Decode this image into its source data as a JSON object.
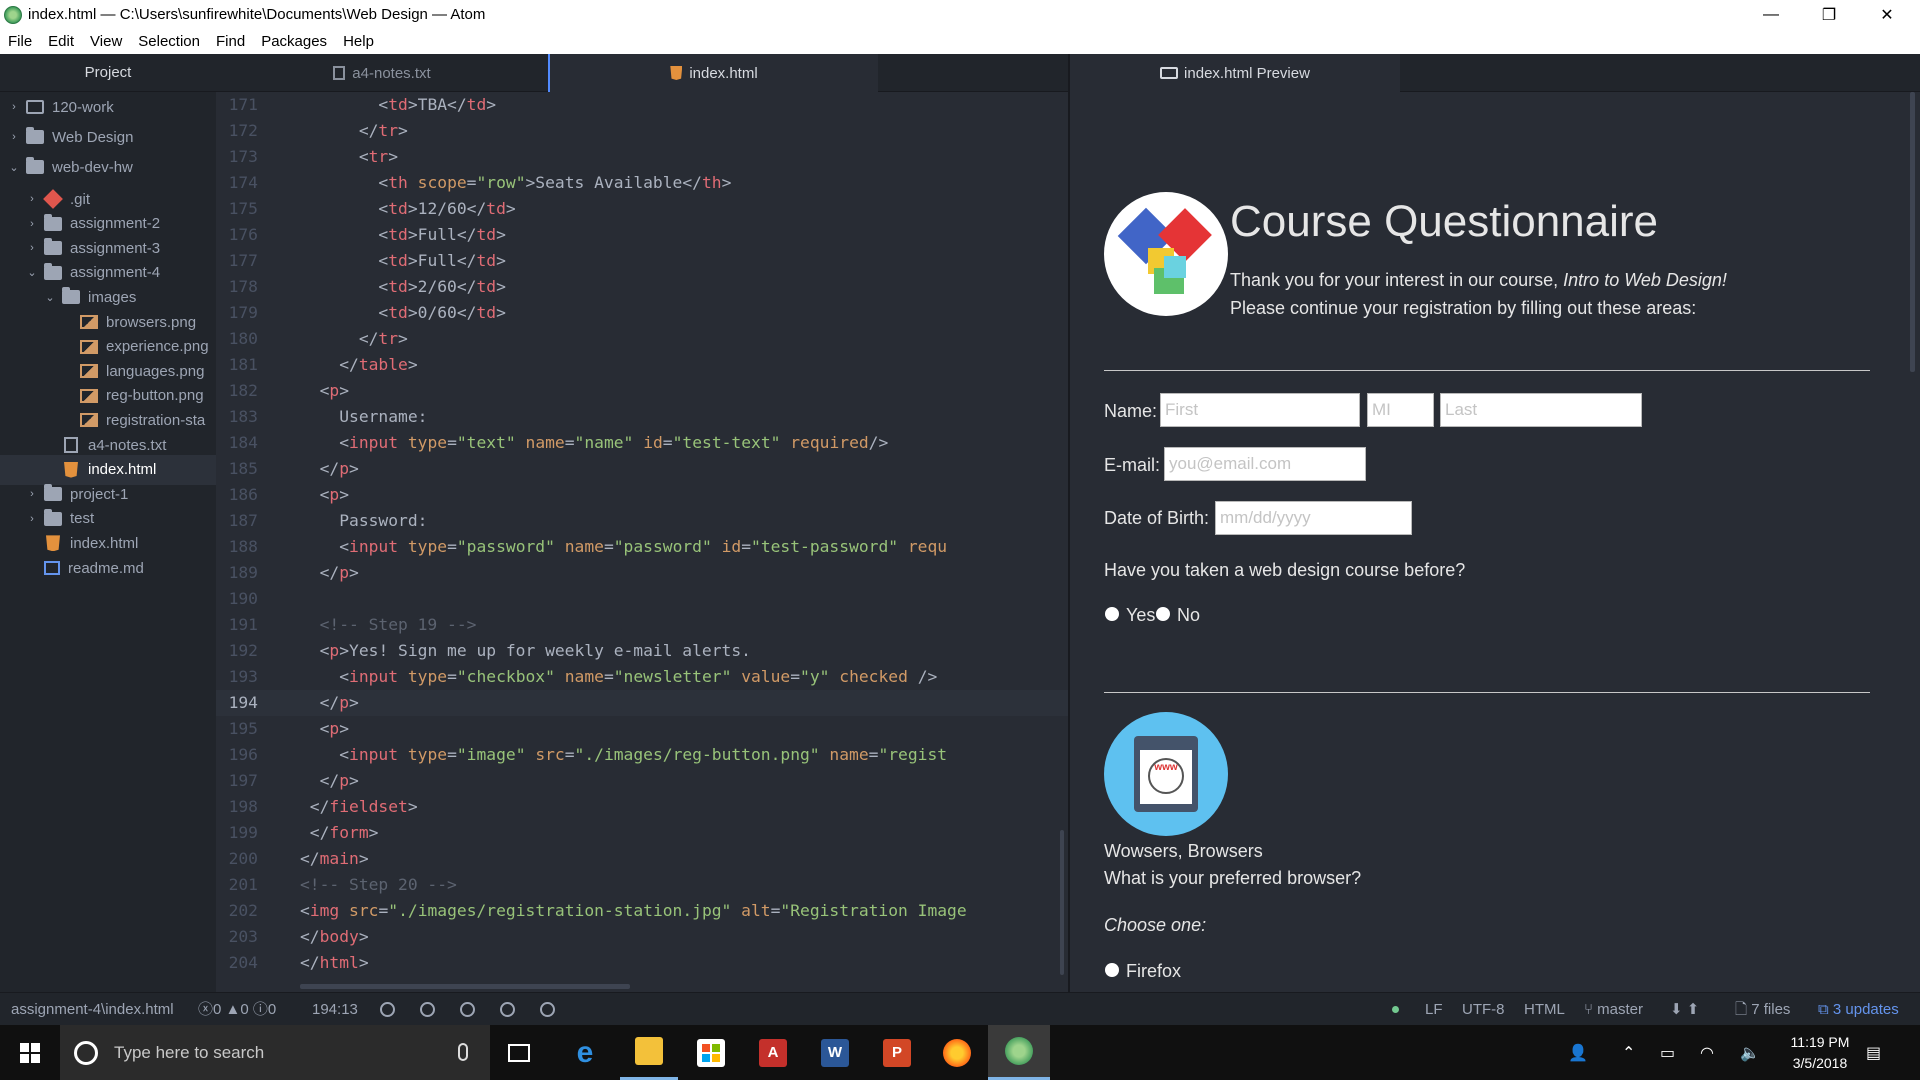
{
  "window": {
    "title": "index.html — C:\\Users\\sunfirewhite\\Documents\\Web Design — Atom",
    "controls": {
      "minimize": "—",
      "maximize": "❐",
      "close": "✕"
    }
  },
  "menu": [
    "File",
    "Edit",
    "View",
    "Selection",
    "Find",
    "Packages",
    "Help"
  ],
  "tree": {
    "header": "Project",
    "items": [
      {
        "label": "120-work",
        "icon": "repo-icon",
        "chevron": "›",
        "depth": 0
      },
      {
        "label": "Web Design",
        "icon": "folder-icon",
        "chevron": "›",
        "depth": 0
      },
      {
        "label": "web-dev-hw",
        "icon": "folder-icon",
        "chevron": "⌄",
        "depth": 0
      },
      {
        "label": ".git",
        "icon": "git-icon",
        "chevron": "›",
        "depth": 1
      },
      {
        "label": "assignment-2",
        "icon": "folder-icon",
        "chevron": "›",
        "depth": 1
      },
      {
        "label": "assignment-3",
        "icon": "folder-icon",
        "chevron": "›",
        "depth": 1
      },
      {
        "label": "assignment-4",
        "icon": "folder-icon",
        "chevron": "⌄",
        "depth": 1
      },
      {
        "label": "images",
        "icon": "folder-icon",
        "chevron": "⌄",
        "depth": 2
      },
      {
        "label": "browsers.png",
        "icon": "image-file-icon",
        "chevron": "",
        "depth": 3
      },
      {
        "label": "experience.png",
        "icon": "image-file-icon",
        "chevron": "",
        "depth": 3
      },
      {
        "label": "languages.png",
        "icon": "image-file-icon",
        "chevron": "",
        "depth": 3
      },
      {
        "label": "reg-button.png",
        "icon": "image-file-icon",
        "chevron": "",
        "depth": 3
      },
      {
        "label": "registration-sta",
        "icon": "image-file-icon",
        "chevron": "",
        "depth": 3
      },
      {
        "label": "a4-notes.txt",
        "icon": "text-file-icon",
        "chevron": "",
        "depth": 2
      },
      {
        "label": "index.html",
        "icon": "html5-icon",
        "chevron": "",
        "depth": 2,
        "selected": true
      },
      {
        "label": "project-1",
        "icon": "folder-icon",
        "chevron": "›",
        "depth": 1
      },
      {
        "label": "test",
        "icon": "folder-icon",
        "chevron": "›",
        "depth": 1
      },
      {
        "label": "index.html",
        "icon": "html5-icon",
        "chevron": "",
        "depth": 1
      },
      {
        "label": "readme.md",
        "icon": "markdown-file-icon",
        "chevron": "",
        "depth": 1
      }
    ]
  },
  "tabs": [
    {
      "label": "a4-notes.txt",
      "icon": "text-file-icon",
      "active": false
    },
    {
      "label": "index.html",
      "icon": "html5-icon",
      "active": true
    }
  ],
  "editor": {
    "cursor_line": 194,
    "lines": [
      {
        "n": "171",
        "tokens": [
          [
            "p",
            "        <"
          ],
          [
            "t",
            "td"
          ],
          [
            "p",
            ">TBA</"
          ],
          [
            "t",
            "td"
          ],
          [
            "p",
            ">"
          ]
        ]
      },
      {
        "n": "172",
        "tokens": [
          [
            "p",
            "      </"
          ],
          [
            "t",
            "tr"
          ],
          [
            "p",
            ">"
          ]
        ]
      },
      {
        "n": "173",
        "tokens": [
          [
            "p",
            "      <"
          ],
          [
            "t",
            "tr"
          ],
          [
            "p",
            ">"
          ]
        ]
      },
      {
        "n": "174",
        "tokens": [
          [
            "p",
            "        <"
          ],
          [
            "t",
            "th"
          ],
          [
            "p",
            " "
          ],
          [
            "a",
            "scope"
          ],
          [
            "p",
            "="
          ],
          [
            "s",
            "\"row\""
          ],
          [
            "p",
            ">Seats Available</"
          ],
          [
            "t",
            "th"
          ],
          [
            "p",
            ">"
          ]
        ]
      },
      {
        "n": "175",
        "tokens": [
          [
            "p",
            "        <"
          ],
          [
            "t",
            "td"
          ],
          [
            "p",
            ">12/60</"
          ],
          [
            "t",
            "td"
          ],
          [
            "p",
            ">"
          ]
        ]
      },
      {
        "n": "176",
        "tokens": [
          [
            "p",
            "        <"
          ],
          [
            "t",
            "td"
          ],
          [
            "p",
            ">Full</"
          ],
          [
            "t",
            "td"
          ],
          [
            "p",
            ">"
          ]
        ]
      },
      {
        "n": "177",
        "tokens": [
          [
            "p",
            "        <"
          ],
          [
            "t",
            "td"
          ],
          [
            "p",
            ">Full</"
          ],
          [
            "t",
            "td"
          ],
          [
            "p",
            ">"
          ]
        ]
      },
      {
        "n": "178",
        "tokens": [
          [
            "p",
            "        <"
          ],
          [
            "t",
            "td"
          ],
          [
            "p",
            ">2/60</"
          ],
          [
            "t",
            "td"
          ],
          [
            "p",
            ">"
          ]
        ]
      },
      {
        "n": "179",
        "tokens": [
          [
            "p",
            "        <"
          ],
          [
            "t",
            "td"
          ],
          [
            "p",
            ">0/60</"
          ],
          [
            "t",
            "td"
          ],
          [
            "p",
            ">"
          ]
        ]
      },
      {
        "n": "180",
        "tokens": [
          [
            "p",
            "      </"
          ],
          [
            "t",
            "tr"
          ],
          [
            "p",
            ">"
          ]
        ]
      },
      {
        "n": "181",
        "tokens": [
          [
            "p",
            "    </"
          ],
          [
            "t",
            "table"
          ],
          [
            "p",
            ">"
          ]
        ]
      },
      {
        "n": "182",
        "tokens": [
          [
            "p",
            "  <"
          ],
          [
            "t",
            "p"
          ],
          [
            "p",
            ">"
          ]
        ]
      },
      {
        "n": "183",
        "tokens": [
          [
            "p",
            "    Username:"
          ]
        ]
      },
      {
        "n": "184",
        "tokens": [
          [
            "p",
            "    <"
          ],
          [
            "t",
            "input"
          ],
          [
            "p",
            " "
          ],
          [
            "a",
            "type"
          ],
          [
            "p",
            "="
          ],
          [
            "s",
            "\"text\""
          ],
          [
            "p",
            " "
          ],
          [
            "a",
            "name"
          ],
          [
            "p",
            "="
          ],
          [
            "s",
            "\"name\""
          ],
          [
            "p",
            " "
          ],
          [
            "a",
            "id"
          ],
          [
            "p",
            "="
          ],
          [
            "s",
            "\"test-text\""
          ],
          [
            "p",
            " "
          ],
          [
            "a",
            "required"
          ],
          [
            "p",
            "/>"
          ]
        ]
      },
      {
        "n": "185",
        "tokens": [
          [
            "p",
            "  </"
          ],
          [
            "t",
            "p"
          ],
          [
            "p",
            ">"
          ]
        ]
      },
      {
        "n": "186",
        "tokens": [
          [
            "p",
            "  <"
          ],
          [
            "t",
            "p"
          ],
          [
            "p",
            ">"
          ]
        ]
      },
      {
        "n": "187",
        "tokens": [
          [
            "p",
            "    Password:"
          ]
        ]
      },
      {
        "n": "188",
        "tokens": [
          [
            "p",
            "    <"
          ],
          [
            "t",
            "input"
          ],
          [
            "p",
            " "
          ],
          [
            "a",
            "type"
          ],
          [
            "p",
            "="
          ],
          [
            "s",
            "\"password\""
          ],
          [
            "p",
            " "
          ],
          [
            "a",
            "name"
          ],
          [
            "p",
            "="
          ],
          [
            "s",
            "\"password\""
          ],
          [
            "p",
            " "
          ],
          [
            "a",
            "id"
          ],
          [
            "p",
            "="
          ],
          [
            "s",
            "\"test-password\""
          ],
          [
            "p",
            " "
          ],
          [
            "a",
            "requ"
          ]
        ]
      },
      {
        "n": "189",
        "tokens": [
          [
            "p",
            "  </"
          ],
          [
            "t",
            "p"
          ],
          [
            "p",
            ">"
          ]
        ]
      },
      {
        "n": "190",
        "tokens": []
      },
      {
        "n": "191",
        "tokens": [
          [
            "c",
            "  <!-- Step 19 -->"
          ]
        ]
      },
      {
        "n": "192",
        "tokens": [
          [
            "p",
            "  <"
          ],
          [
            "t",
            "p"
          ],
          [
            "p",
            ">Yes! Sign me up for weekly e-mail alerts."
          ]
        ]
      },
      {
        "n": "193",
        "tokens": [
          [
            "p",
            "    <"
          ],
          [
            "t",
            "input"
          ],
          [
            "p",
            " "
          ],
          [
            "a",
            "type"
          ],
          [
            "p",
            "="
          ],
          [
            "s",
            "\"checkbox\""
          ],
          [
            "p",
            " "
          ],
          [
            "a",
            "name"
          ],
          [
            "p",
            "="
          ],
          [
            "s",
            "\"newsletter\""
          ],
          [
            "p",
            " "
          ],
          [
            "a",
            "value"
          ],
          [
            "p",
            "="
          ],
          [
            "s",
            "\"y\""
          ],
          [
            "p",
            " "
          ],
          [
            "a",
            "checked"
          ],
          [
            "p",
            " />"
          ]
        ]
      },
      {
        "n": "194",
        "tokens": [
          [
            "p",
            "  </"
          ],
          [
            "t",
            "p"
          ],
          [
            "p",
            ">"
          ]
        ]
      },
      {
        "n": "195",
        "tokens": [
          [
            "p",
            "  <"
          ],
          [
            "t",
            "p"
          ],
          [
            "p",
            ">"
          ]
        ]
      },
      {
        "n": "196",
        "tokens": [
          [
            "p",
            "    <"
          ],
          [
            "t",
            "input"
          ],
          [
            "p",
            " "
          ],
          [
            "a",
            "type"
          ],
          [
            "p",
            "="
          ],
          [
            "s",
            "\"image\""
          ],
          [
            "p",
            " "
          ],
          [
            "a",
            "src"
          ],
          [
            "p",
            "="
          ],
          [
            "s",
            "\"./images/reg-button.png\""
          ],
          [
            "p",
            " "
          ],
          [
            "a",
            "name"
          ],
          [
            "p",
            "="
          ],
          [
            "s",
            "\"regist"
          ]
        ]
      },
      {
        "n": "197",
        "tokens": [
          [
            "p",
            "  </"
          ],
          [
            "t",
            "p"
          ],
          [
            "p",
            ">"
          ]
        ]
      },
      {
        "n": "198",
        "tokens": [
          [
            "p",
            " </"
          ],
          [
            "t",
            "fieldset"
          ],
          [
            "p",
            ">"
          ]
        ]
      },
      {
        "n": "199",
        "tokens": [
          [
            "p",
            " </"
          ],
          [
            "t",
            "form"
          ],
          [
            "p",
            ">"
          ]
        ]
      },
      {
        "n": "200",
        "tokens": [
          [
            "p",
            "</"
          ],
          [
            "t",
            "main"
          ],
          [
            "p",
            ">"
          ]
        ]
      },
      {
        "n": "201",
        "tokens": [
          [
            "c",
            "<!-- Step 20 -->"
          ]
        ]
      },
      {
        "n": "202",
        "tokens": [
          [
            "p",
            "<"
          ],
          [
            "t",
            "img"
          ],
          [
            "p",
            " "
          ],
          [
            "a",
            "src"
          ],
          [
            "p",
            "="
          ],
          [
            "s",
            "\"./images/registration-station.jpg\""
          ],
          [
            "p",
            " "
          ],
          [
            "a",
            "alt"
          ],
          [
            "p",
            "="
          ],
          [
            "s",
            "\"Registration Image"
          ]
        ]
      },
      {
        "n": "203",
        "tokens": [
          [
            "p",
            "</"
          ],
          [
            "t",
            "body"
          ],
          [
            "p",
            ">"
          ]
        ]
      },
      {
        "n": "204",
        "tokens": [
          [
            "p",
            "</"
          ],
          [
            "t",
            "html"
          ],
          [
            "p",
            ">"
          ]
        ]
      }
    ]
  },
  "preview": {
    "tab_label": "index.html Preview",
    "title": "Course Questionnaire",
    "intro_line1_plain": "Thank you for your interest in our course, ",
    "intro_line1_italic": "Intro to Web Design!",
    "intro_line2": "Please continue your registration by filling out these areas:",
    "name_label": "Name:",
    "first_placeholder": "First",
    "mi_placeholder": "MI",
    "last_placeholder": "Last",
    "email_label": "E-mail:",
    "email_placeholder": "you@email.com",
    "dob_label": "Date of Birth:",
    "dob_placeholder": "mm/dd/yyyy",
    "question_course": "Have you taken a web design course before?",
    "yes_label": "Yes",
    "no_label": "No",
    "browser_heading": "Wowsers, Browsers",
    "browser_question": "What is your preferred browser?",
    "choose_one": "Choose one:",
    "firefox_label": "Firefox",
    "browser_icon_text": "www"
  },
  "status": {
    "path": "assignment-4\\index.html",
    "errors": "0",
    "warnings": "0",
    "infos": "0",
    "cursor": "194:13",
    "line_ending": "LF",
    "encoding": "UTF-8",
    "grammar": "HTML",
    "branch": "master",
    "files": "7 files",
    "updates": "3 updates"
  },
  "taskbar": {
    "search_placeholder": "Type here to search",
    "time": "11:19 PM",
    "date": "3/5/2018",
    "apps": [
      "task-view-icon",
      "edge-icon",
      "file-explorer-icon",
      "store-icon",
      "access-icon",
      "word-icon",
      "powerpoint-icon",
      "firefox-icon",
      "atom-icon"
    ]
  },
  "colors": {
    "editor_bg": "#282c34",
    "sidebar_bg": "#21252b",
    "tag": "#e06c75",
    "attr": "#d19a66",
    "string": "#98c379",
    "comment": "#5c6370",
    "accent": "#528bff"
  }
}
